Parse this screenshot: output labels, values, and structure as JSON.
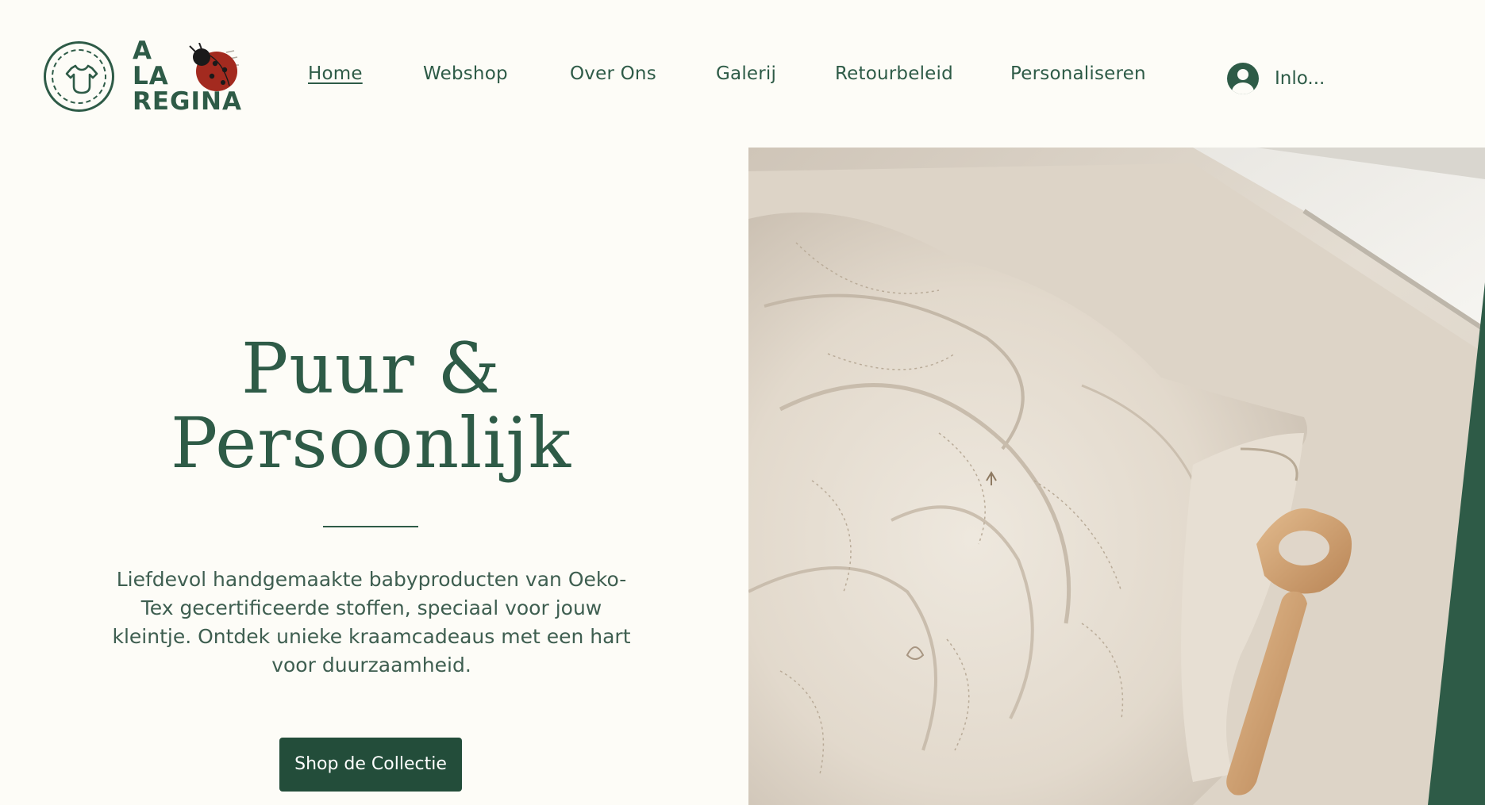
{
  "brand": {
    "line1": "A",
    "line2": "LA",
    "line3": "REGINA",
    "badge_icon": "onesie-icon",
    "mascot_icon": "ladybug-icon"
  },
  "nav": {
    "items": [
      {
        "label": "Home",
        "active": true
      },
      {
        "label": "Webshop",
        "active": false
      },
      {
        "label": "Over Ons",
        "active": false
      },
      {
        "label": "Galerij",
        "active": false
      },
      {
        "label": "Retourbeleid",
        "active": false
      },
      {
        "label": "Personaliseren",
        "active": false
      }
    ]
  },
  "account": {
    "label": "Inlo...",
    "icon": "user-avatar-icon"
  },
  "hero": {
    "title_line1": "Puur &",
    "title_line2": "Persoonlijk",
    "description": "Liefdevol handgemaakte babyproducten van Oeko-Tex gecertificeerde stoffen, speciaal voor jouw kleintje. Ontdek unieke kraamcadeaus met een hart voor duurzaamheid.",
    "cta_label": "Shop de Collectie",
    "image_subject": "quilted-blanket-with-wooden-rattle"
  },
  "colors": {
    "primary_green": "#2e5b47",
    "button_green": "#234d3a",
    "background": "#fdfcf7",
    "ladybug_red": "#a32a1f"
  }
}
